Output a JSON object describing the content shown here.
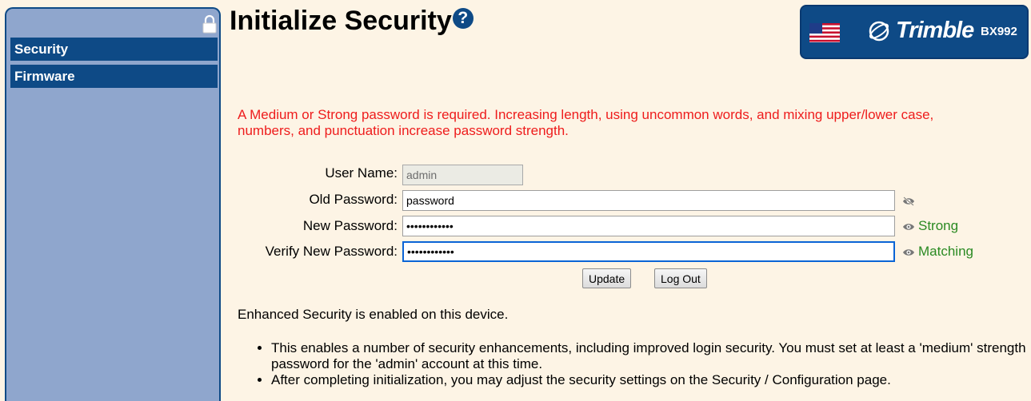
{
  "sidebar": {
    "items": [
      {
        "label": "Security"
      },
      {
        "label": "Firmware"
      }
    ]
  },
  "page": {
    "title": "Initialize Security",
    "help_icon": "?"
  },
  "brand": {
    "name": "Trimble",
    "model": "BX992",
    "flag_icon": "us-flag-icon"
  },
  "warning": "A Medium or Strong password is required. Increasing length, using uncommon words, and mixing upper/lower case, numbers, and punctuation increase password strength.",
  "form": {
    "username_label": "User Name:",
    "username_value": "admin",
    "old_password_label": "Old Password:",
    "old_password_value": "password",
    "new_password_label": "New Password:",
    "new_password_value": "••••••••••••",
    "new_password_strength": "Strong",
    "verify_label": "Verify New Password:",
    "verify_value": "••••••••••••",
    "verify_status": "Matching",
    "update_button": "Update",
    "logout_button": "Log Out"
  },
  "info": {
    "text": "Enhanced Security is enabled on this device.",
    "bullets": [
      "This enables a number of security enhancements, including improved login security. You must set at least a 'medium' strength password for the 'admin' account at this time.",
      "After completing initialization, you may adjust the security settings on the Security / Configuration page."
    ]
  },
  "colors": {
    "accent": "#0e4a86",
    "sidebar_bg": "#8fa6cd",
    "page_bg": "#fdf4e5",
    "warning": "#ee1c1c",
    "status_ok": "#2a8a22"
  }
}
